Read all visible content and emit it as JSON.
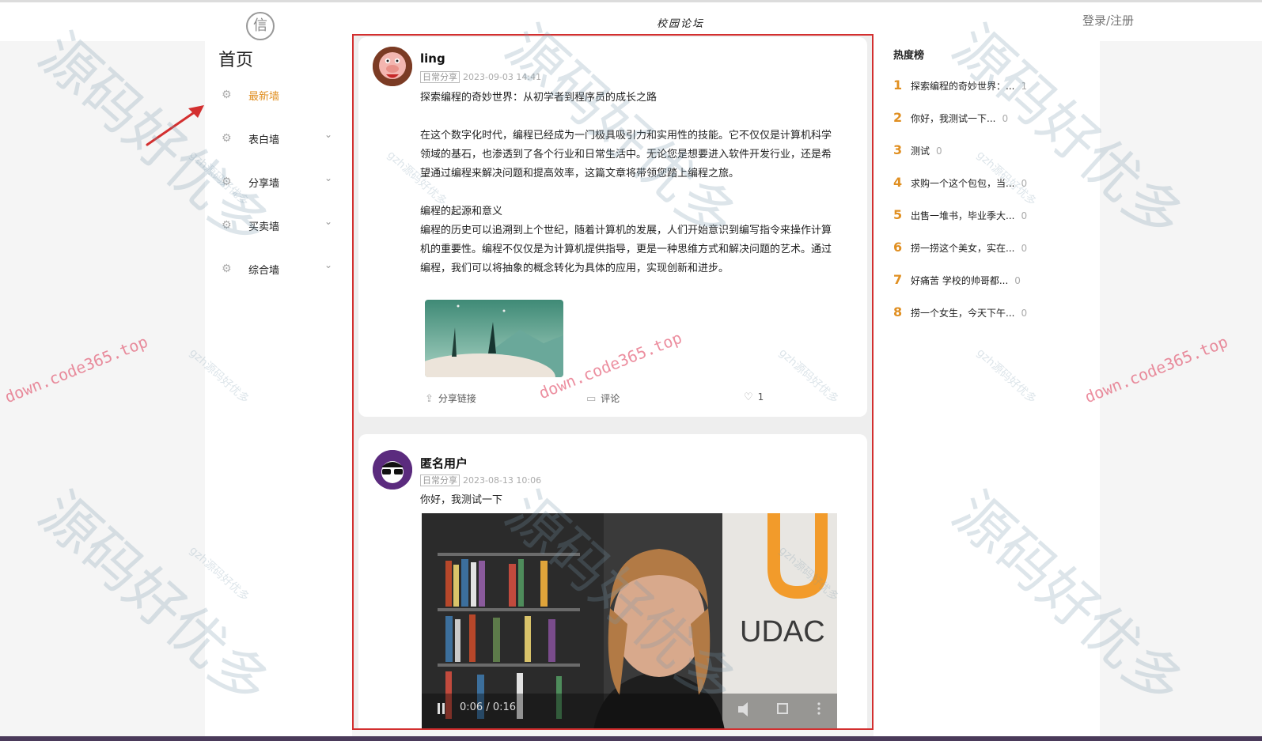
{
  "header": {
    "logo_glyph": "信",
    "site_title": "校园论坛",
    "login_label": "登录/注册"
  },
  "sidebar": {
    "home_title": "首页",
    "items": [
      {
        "label": "最新墙",
        "active": true
      },
      {
        "label": "表白墙",
        "active": false
      },
      {
        "label": "分享墙",
        "active": false
      },
      {
        "label": "买卖墙",
        "active": false
      },
      {
        "label": "综合墙",
        "active": false
      }
    ]
  },
  "posts": [
    {
      "author": "ling",
      "tag": "日常分享",
      "time": "2023-09-03 14:41",
      "paragraphs": [
        "探索编程的奇妙世界：从初学者到程序员的成长之路",
        "",
        "在这个数字化时代，编程已经成为一门极具吸引力和实用性的技能。它不仅仅是计算机科学领域的基石，也渗透到了各个行业和日常生活中。无论您是想要进入软件开发行业，还是希望通过编程来解决问题和提高效率，这篇文章将带领您踏上编程之旅。",
        "",
        "编程的起源和意义",
        "编程的历史可以追溯到上个世纪，随着计算机的发展，人们开始意识到编写指令来操作计算机的重要性。编程不仅仅是为计算机提供指导，更是一种思维方式和解决问题的艺术。通过编程，我们可以将抽象的概念转化为具体的应用，实现创新和进步。"
      ],
      "share_label": "分享链接",
      "comment_label": "评论",
      "likes": "1"
    },
    {
      "author": "匿名用户",
      "tag": "日常分享",
      "time": "2023-08-13 10:06",
      "body": "你好，我测试一下",
      "video_time": "0:06 / 0:16",
      "video_brand": "UDAC"
    }
  ],
  "hot": {
    "title": "热度榜",
    "items": [
      {
        "rank": "1",
        "text": "探索编程的奇妙世界：...",
        "count": "1"
      },
      {
        "rank": "2",
        "text": "你好，我测试一下...",
        "count": "0"
      },
      {
        "rank": "3",
        "text": "测试",
        "count": "0"
      },
      {
        "rank": "4",
        "text": "求购一个这个包包，当...",
        "count": "0"
      },
      {
        "rank": "5",
        "text": "出售一堆书，毕业季大...",
        "count": "0"
      },
      {
        "rank": "6",
        "text": "捞一捞这个美女，实在...",
        "count": "0"
      },
      {
        "rank": "7",
        "text": "好痛苦 学校的帅哥都...",
        "count": "0"
      },
      {
        "rank": "8",
        "text": "捞一个女生，今天下午...",
        "count": "0"
      }
    ]
  },
  "watermarks": {
    "big": "源码好优多",
    "url": "down.code365.top",
    "small": "gzh源码好优多"
  },
  "colors": {
    "accent": "#e08f21",
    "frame": "#d32f2f",
    "arrow": "#d32f2f"
  }
}
